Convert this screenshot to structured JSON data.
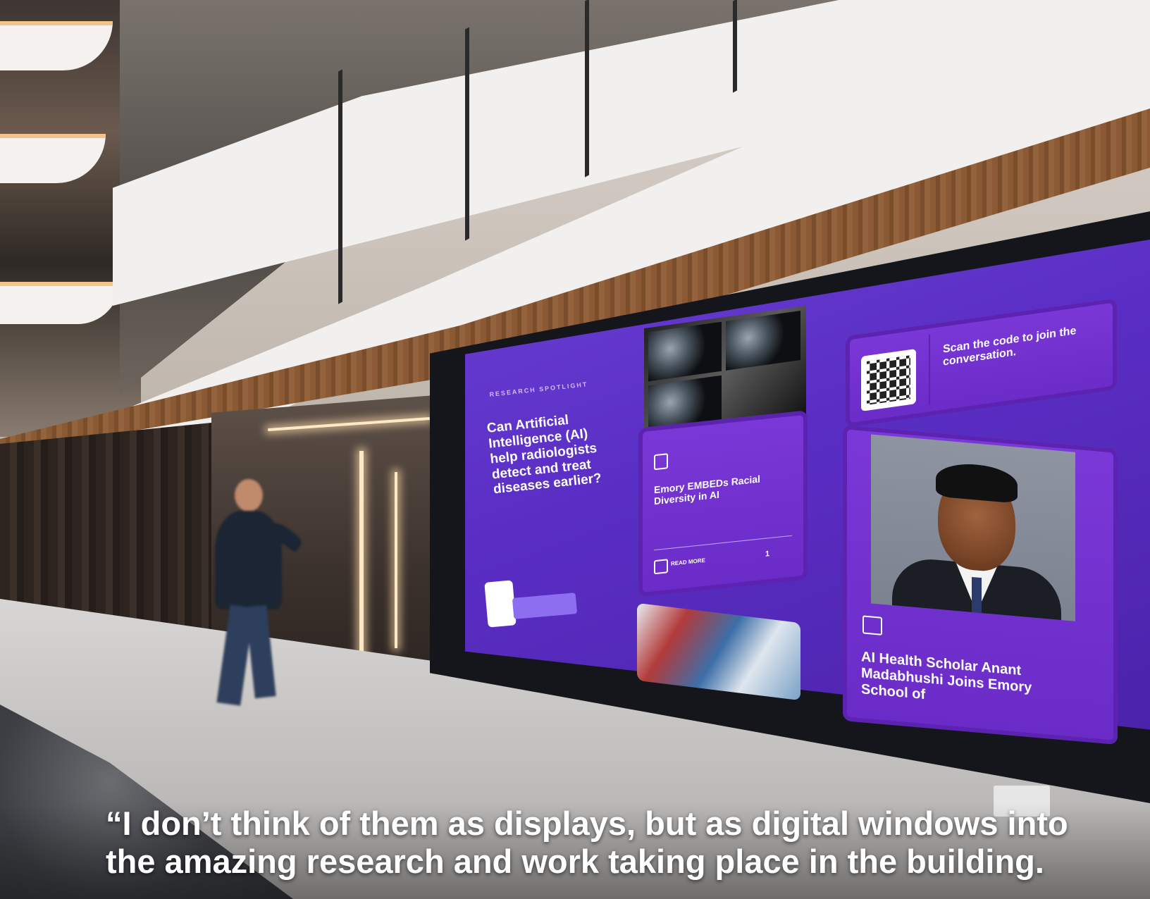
{
  "screen": {
    "kicker_research": "RESEARCH SPOTLIGHT",
    "headline": "Can Artificial Intelligence (AI) help radiologists detect and treat diseases earlier?",
    "qr_button": "",
    "story_title": "Emory EMBEDs Racial Diversity in AI",
    "read_label": "READ MORE",
    "read_count": "1",
    "scan_text": "Scan the code to join the conversation.",
    "scholar_title": "AI Health Scholar Anant Madabhushi Joins Emory School of"
  },
  "caption": {
    "line": "“I don’t think of them as displays, but as digital windows into the amazing research and work taking place in the building."
  },
  "colors": {
    "screen_purple": "#5a2ec4",
    "card_purple": "#7b38d8",
    "wood": "#8b5a34"
  }
}
